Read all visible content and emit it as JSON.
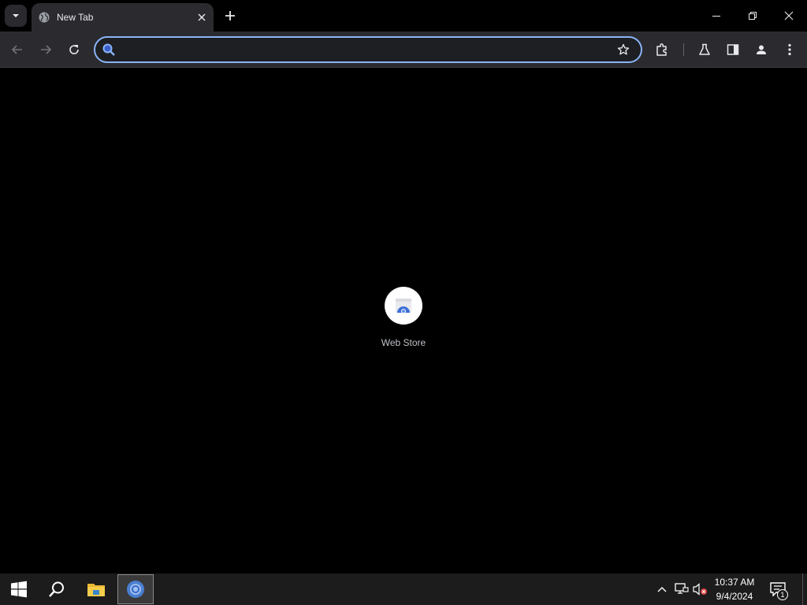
{
  "browser": {
    "tab_search_icon": "chevron-down-icon",
    "tab": {
      "title": "New Tab",
      "favicon": "globe-icon"
    },
    "new_tab_icon": "plus-icon",
    "window_controls": [
      "minimize-icon",
      "restore-icon",
      "close-icon"
    ],
    "toolbar": {
      "back_icon": "arrow-left-icon",
      "forward_icon": "arrow-right-icon",
      "reload_icon": "reload-icon",
      "omnibox": {
        "value": "",
        "placeholder": "",
        "search_icon": "search-icon",
        "bookmark_icon": "star-icon"
      },
      "right_icons": [
        "puzzle-icon",
        "flask-icon",
        "side-panel-icon",
        "profile-icon",
        "more-vert-icon"
      ]
    }
  },
  "new_tab_page": {
    "shortcuts": [
      {
        "label": "Web Store",
        "icon": "web-store-icon"
      }
    ]
  },
  "taskbar": {
    "start_icon": "windows-icon",
    "search_icon": "search-icon",
    "pinned": [
      {
        "name": "file-explorer-icon"
      },
      {
        "name": "chrome-icon",
        "active": true
      }
    ],
    "tray": {
      "icons": [
        "chevron-up-icon",
        "network-icon",
        "volume-muted-icon"
      ],
      "time": "10:37 AM",
      "date": "9/4/2024",
      "notification_count": "1"
    }
  },
  "colors": {
    "accent": "#8ab4f8",
    "toolbar_bg": "#2b2b2f",
    "page_bg": "#000000",
    "taskbar_bg": "#1c1c1c"
  }
}
